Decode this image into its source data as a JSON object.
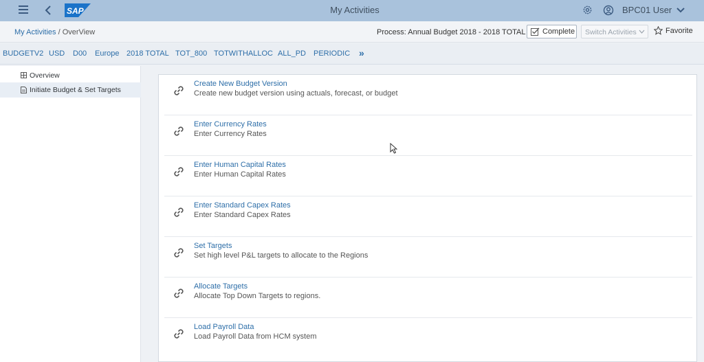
{
  "shell": {
    "title": "My Activities",
    "user": "BPC01 User",
    "logo_text": "SAP",
    "icons": [
      "menu-icon",
      "back-icon",
      "gear-icon",
      "user-icon",
      "chevron-down-icon"
    ]
  },
  "subheader": {
    "breadcrumb_link": "My Activities",
    "breadcrumb_current": "/ OverView",
    "process": "Process:  Annual Budget 2018 - 2018 TOTAL",
    "complete_label": "Complete",
    "switch_label": "Switch Activities",
    "favorite_label": "Favorite"
  },
  "context": {
    "items": [
      "BUDGETV2",
      "USD",
      "D00",
      "Europe",
      "2018 TOTAL",
      "TOT_800",
      "TOTWITHALLOC",
      "ALL_PD",
      "PERIODIC"
    ],
    "more": "»"
  },
  "sidebar": {
    "items": [
      {
        "label": "Overview",
        "icon": "overview-icon"
      },
      {
        "label": "Initiate Budget & Set Targets",
        "icon": "document-icon"
      }
    ]
  },
  "activities": [
    {
      "title": "Create New Budget Version",
      "desc": "Create new budget version using actuals, forecast, or budget"
    },
    {
      "title": "Enter Currency Rates",
      "desc": "Enter Currency Rates"
    },
    {
      "title": "Enter Human Capital Rates",
      "desc": "Enter Human Capital Rates"
    },
    {
      "title": "Enter Standard Capex Rates",
      "desc": "Enter Standard Capex Rates"
    },
    {
      "title": "Set Targets",
      "desc": "Set high level P&L targets to allocate to the Regions"
    },
    {
      "title": "Allocate Targets",
      "desc": "Allocate Top Down Targets to regions."
    },
    {
      "title": "Load Payroll Data",
      "desc": "Load Payroll Data from HCM system"
    }
  ],
  "colors": {
    "shell": "#a9c2dc",
    "link": "#2d6ea8",
    "background": "#eef1f5"
  }
}
